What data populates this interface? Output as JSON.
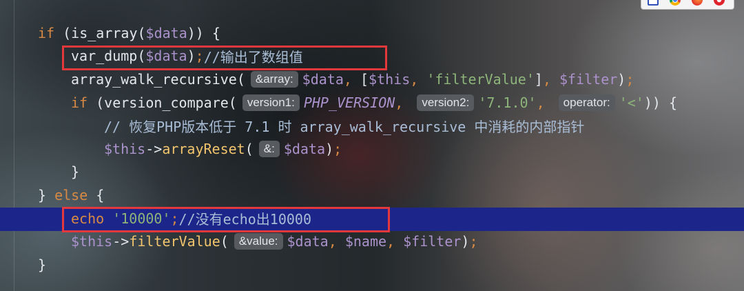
{
  "theme": {
    "keyword": "#d88a45",
    "text": "#e3e6ea",
    "variable": "#ab92cc",
    "string": "#8db57a",
    "method": "#f2c46d",
    "comment": "#a9bdd6",
    "hint-bg": "#575b60",
    "hint-text": "#e2e4e7",
    "line-highlight": "#1c2589",
    "annotation": "#e5383d"
  },
  "browser_toolbar": {
    "icons": [
      "phpstorm-icon",
      "chrome-icon",
      "firefox-icon",
      "opera-icon"
    ]
  },
  "editor": {
    "lines": [
      [
        "if",
        " (is_array(",
        "$data",
        ")) {"
      ],
      [
        "var_dump(",
        "$data",
        ")",
        ";",
        "//输出了数组值"
      ],
      [
        "array_walk_recursive(",
        "&array:",
        "$data",
        ",",
        " [",
        "$this",
        ",",
        " 'filterValue'",
        "]",
        ",",
        " $filter",
        ")",
        ";"
      ],
      [
        "if",
        " (version_compare(",
        "version1:",
        "PHP_VERSION",
        ",",
        "version2:",
        "'7.1.0'",
        ",",
        "operator:",
        "'<'",
        ")) {"
      ],
      [
        "// 恢复PHP版本低于 7.1 时 array_walk_recursive 中消耗的内部指针"
      ],
      [
        "$this",
        "->",
        "arrayReset",
        "(",
        "&:",
        "$data",
        ")",
        ";"
      ],
      [
        "}"
      ],
      [
        "} ",
        "else",
        " {"
      ],
      [
        "echo",
        " '10000'",
        ";",
        "//没有echo出10000"
      ],
      [
        "$this",
        "->",
        "filterValue",
        "(",
        "&value:",
        "$data",
        ",",
        " $name",
        ",",
        " $filter",
        ")",
        ";"
      ],
      [
        "}"
      ]
    ]
  }
}
